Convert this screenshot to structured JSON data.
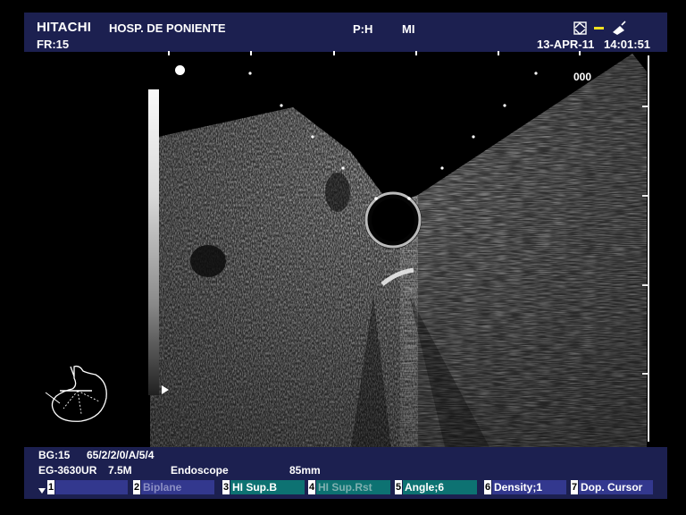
{
  "header": {
    "brand": "HITACHI",
    "hospital": "HOSP. DE PONIENTE",
    "ph": "P:H",
    "mi": "MI",
    "frame_rate": "FR:15",
    "date": "13-APR-11",
    "time": "14:01:51",
    "status_icons": [
      "probe-orientation-icon",
      "freeze-dash-icon",
      "transducer-icon"
    ]
  },
  "image": {
    "depth_label": "000"
  },
  "footer": {
    "bg": "BG:15",
    "params": "65/2/2/0/A/5/4",
    "probe": "EG-3630UR",
    "frequency": "7.5M",
    "mode": "Endoscope",
    "depth": "85mm"
  },
  "function_keys": [
    {
      "num": "1",
      "label": ""
    },
    {
      "num": "2",
      "label": "Biplane"
    },
    {
      "num": "3",
      "label": "HI Sup.B"
    },
    {
      "num": "4",
      "label": "HI Sup.Rst"
    },
    {
      "num": "5",
      "label": "Angle;6"
    },
    {
      "num": "6",
      "label": "Density;1"
    },
    {
      "num": "7",
      "label": "Dop. Cursor"
    }
  ],
  "colors": {
    "panel": "#1c2050",
    "key_blue": "#33388e",
    "key_teal": "#0d7272",
    "key_disabled_text": "#8c8fc4"
  }
}
